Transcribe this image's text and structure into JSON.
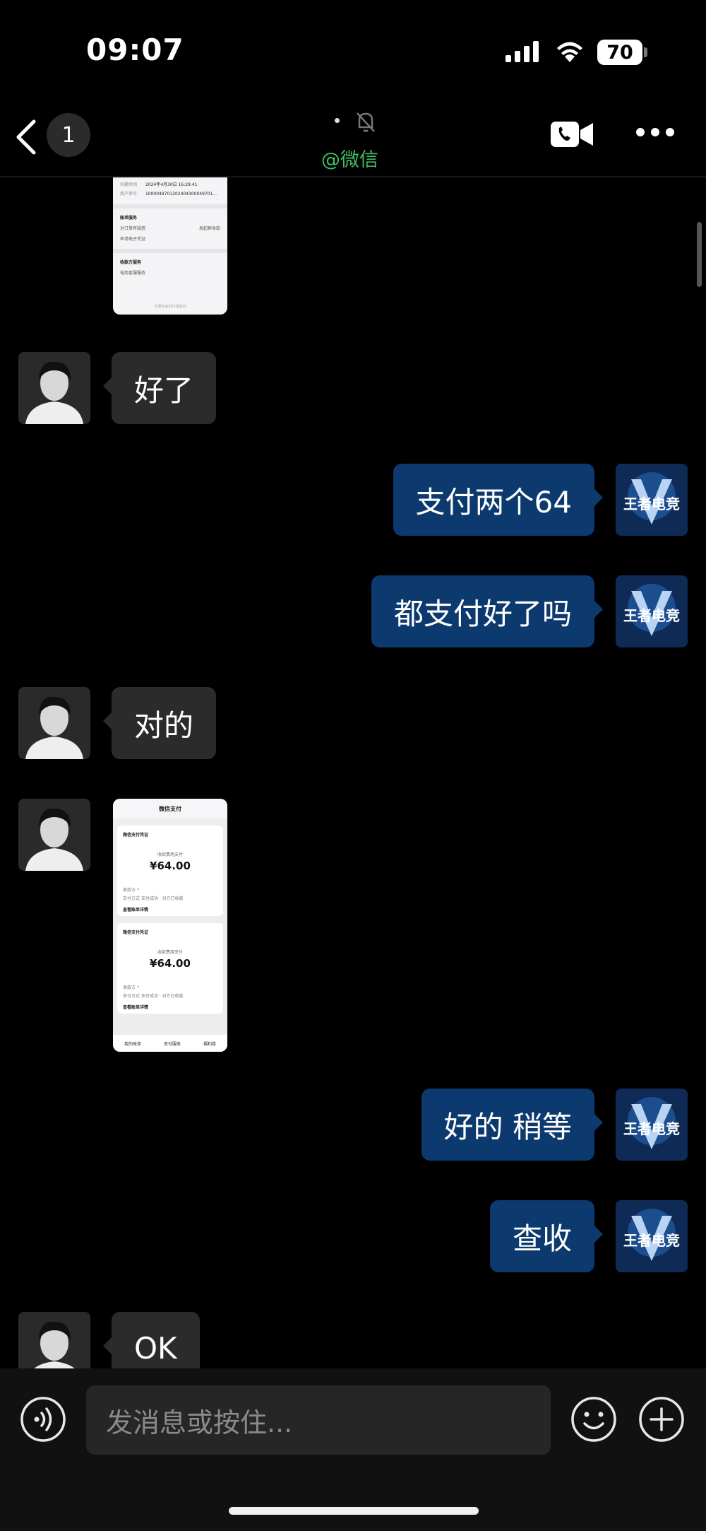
{
  "status_bar": {
    "time": "09:07",
    "battery": "70"
  },
  "nav": {
    "unread_count": "1",
    "subtitle": "@微信"
  },
  "thumb1": {
    "row1_label": "创建时间",
    "row1_value": "2024年4月30日 16:29:41",
    "row2_label": "商户单号",
    "row2_value": "1000049701202404300049701...",
    "section1": "账单服务",
    "actions": [
      "对订单有疑惑",
      "发起群收款",
      "申请电子凭证"
    ],
    "section2": "收款方服务",
    "service": "电商客服服务",
    "footer": "本服务由财付通提供"
  },
  "thumb2": {
    "header_title": "微信支付",
    "cards": [
      {
        "title": "微信支付凭证",
        "sub": "收款费用支付",
        "amount": "¥64.00",
        "l1": "收款方",
        "v1": "*",
        "l2": "支付方式",
        "v2": "支付成功 · 对方已收款",
        "link": "查看账单详情"
      },
      {
        "title": "微信支付凭证",
        "sub": "收款费用支付",
        "amount": "¥64.00",
        "l1": "收款方",
        "v1": "*",
        "l2": "支付方式",
        "v2": "支付成功 · 对方已收款",
        "link": "查看账单详情"
      }
    ],
    "tabs": [
      "我的账单",
      "支付服务",
      "福利卷"
    ]
  },
  "messages": [
    {
      "dir": "in",
      "text": "好了"
    },
    {
      "dir": "out",
      "text": "支付两个64"
    },
    {
      "dir": "out",
      "text": "都支付好了吗"
    },
    {
      "dir": "in",
      "text": "对的"
    },
    {
      "dir": "out",
      "text": "好的 稍等"
    },
    {
      "dir": "out",
      "text": "查收"
    },
    {
      "dir": "in",
      "text": "OK"
    }
  ],
  "input": {
    "placeholder": "发消息或按住..."
  },
  "logo_text": "王者电竞",
  "icons": [
    "back-icon",
    "mute-bell-icon",
    "video-call-icon",
    "more-icon",
    "voice-icon",
    "emoji-icon",
    "add-icon"
  ],
  "colors": {
    "accent_green": "#3fbf63",
    "outgoing_bubble": "#0d3a6e",
    "incoming_bubble": "#2b2b2b"
  }
}
